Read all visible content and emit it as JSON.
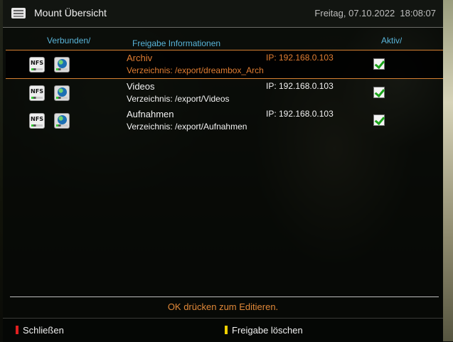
{
  "header": {
    "title": "Mount Übersicht",
    "datetime": "Freitag, 07.10.2022  18:08:07",
    "icon": "network-mount-icon"
  },
  "columns": {
    "connected": "Verbunden/",
    "info": "Freigabe Informationen",
    "active": "Aktiv/"
  },
  "mounts": [
    {
      "type": "NFS",
      "name": "Archiv",
      "directory": "Verzeichnis: /export/dreambox_Archiv",
      "ip": "IP: 192.168.0.103",
      "active": true,
      "selected": true
    },
    {
      "type": "NFS",
      "name": "Videos",
      "directory": "Verzeichnis: /export/Videos",
      "ip": "IP: 192.168.0.103",
      "active": true,
      "selected": false
    },
    {
      "type": "NFS",
      "name": "Aufnahmen",
      "directory": "Verzeichnis: /export/Aufnahmen",
      "ip": "IP: 192.168.0.103",
      "active": true,
      "selected": false
    }
  ],
  "hint": "OK drücken zum Editieren.",
  "buttons": {
    "red": {
      "label": "Schließen",
      "color": "#e02020"
    },
    "yellow": {
      "label": "Freigabe löschen",
      "color": "#f0d000"
    }
  },
  "colors": {
    "accent": "#e07d32",
    "column_header": "#59b4d9"
  }
}
